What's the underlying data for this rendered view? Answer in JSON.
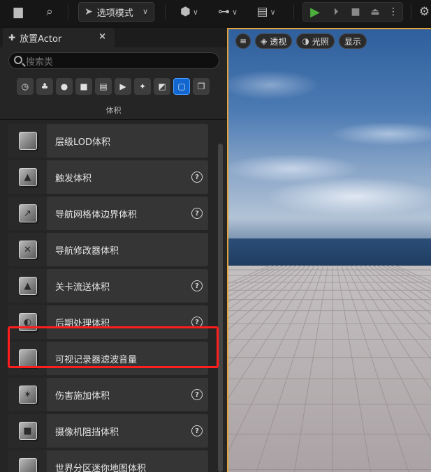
{
  "toolbar": {
    "mode_label": "选项模式"
  },
  "panel": {
    "title": "放置Actor",
    "search_placeholder": "搜索类",
    "section_label": "体积",
    "categories": [
      {
        "icon": "clock-icon",
        "glyph": "◷"
      },
      {
        "icon": "lights-icon",
        "glyph": "♣"
      },
      {
        "icon": "lightbulb-icon",
        "glyph": "●"
      },
      {
        "icon": "cube-icon",
        "glyph": "■"
      },
      {
        "icon": "clapper-icon",
        "glyph": "▤"
      },
      {
        "icon": "media-play-icon",
        "glyph": "▶"
      },
      {
        "icon": "sparkle-icon",
        "glyph": "✦"
      },
      {
        "icon": "shapes-icon",
        "glyph": "◩"
      },
      {
        "icon": "volume-icon",
        "glyph": "▢",
        "active": true
      },
      {
        "icon": "layers-icon",
        "glyph": "❐"
      }
    ],
    "items": [
      {
        "label": "层级LOD体积",
        "help": false,
        "thumb": ""
      },
      {
        "label": "触发体积",
        "help": true,
        "thumb": "▲"
      },
      {
        "label": "导航网格体边界体积",
        "help": true,
        "thumb": "↗"
      },
      {
        "label": "导航修改器体积",
        "help": false,
        "thumb": "✕"
      },
      {
        "label": "关卡流送体积",
        "help": true,
        "thumb": "▲"
      },
      {
        "label": "后期处理体积",
        "help": true,
        "thumb": "◐"
      },
      {
        "label": "可视记录器滤波音量",
        "help": false,
        "thumb": ""
      },
      {
        "label": "伤害施加体积",
        "help": true,
        "thumb": "✶"
      },
      {
        "label": "摄像机阻挡体积",
        "help": true,
        "thumb": "■"
      },
      {
        "label": "世界分区迷你地图体积",
        "help": false,
        "thumb": ""
      }
    ]
  },
  "viewport": {
    "menu_label": "≡",
    "perspective_label": "透视",
    "lighting_label": "光照",
    "show_label": "显示"
  },
  "colors": {
    "accent_blue": "#1166d0",
    "highlight_red": "#ff1d1d",
    "viewport_border": "#e3a23a",
    "play_green": "#4caf3c"
  }
}
